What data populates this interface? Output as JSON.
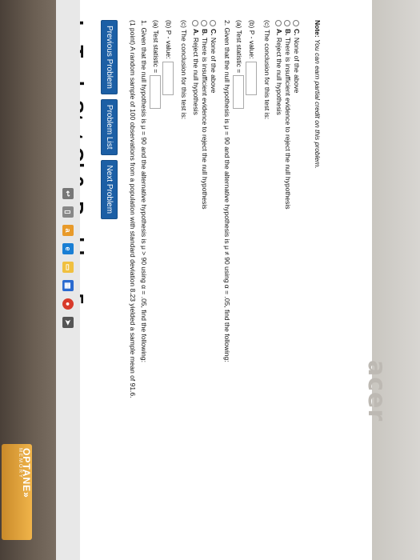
{
  "sticker": {
    "brand": "OPTANE",
    "chevrons": "»",
    "sub": "MEMORY"
  },
  "logo": {
    "text": "acer"
  },
  "page": {
    "title": "LaTech Stat Ch6: Problem 5",
    "nav": {
      "prev": "Previous Problem",
      "list": "Problem List",
      "next": "Next Problem"
    },
    "intro": "(1 point) A random sample of 100 observations from a population with standard deviation 8.23 yielded a sample mean of 91.6.",
    "q1": {
      "stem": "1. Given that the null hypothesis is μ = 90 and the alternative hypothesis is μ > 90 using α = .05, find the following:",
      "a": "(a) Test statistic =",
      "b": "(b) P - value:",
      "c": "(c) The conclusion for this test is:",
      "options": [
        {
          "letter": "A.",
          "text": "Reject the null hypothesis"
        },
        {
          "letter": "B.",
          "text": "There is insufficient evidence to reject the null hypothesis"
        },
        {
          "letter": "C.",
          "text": "None of the above"
        }
      ]
    },
    "q2": {
      "stem": "2. Given that the null hypothesis is μ = 90 and the alternative hypothesis is μ ≠ 90 using α = .05, find the following:",
      "a": "(a) Test statistic =",
      "b": "(b) P - value:",
      "c": "(c) The conclusion for this test is:",
      "options": [
        {
          "letter": "A.",
          "text": "Reject the null hypothesis"
        },
        {
          "letter": "B.",
          "text": "There is insufficient evidence to reject the null hypothesis"
        },
        {
          "letter": "C.",
          "text": "None of the above"
        }
      ]
    },
    "note_label": "Note:",
    "note": "You can earn partial credit on this problem."
  },
  "taskbar": {
    "icons": [
      "back-icon",
      "taskview-icon",
      "amazon-icon",
      "edge-icon",
      "files-icon",
      "store-icon",
      "chrome-icon",
      "arrow-icon"
    ]
  },
  "colors": {
    "nav_button": "#1c5fa5",
    "sticker": "#f0b44a"
  }
}
